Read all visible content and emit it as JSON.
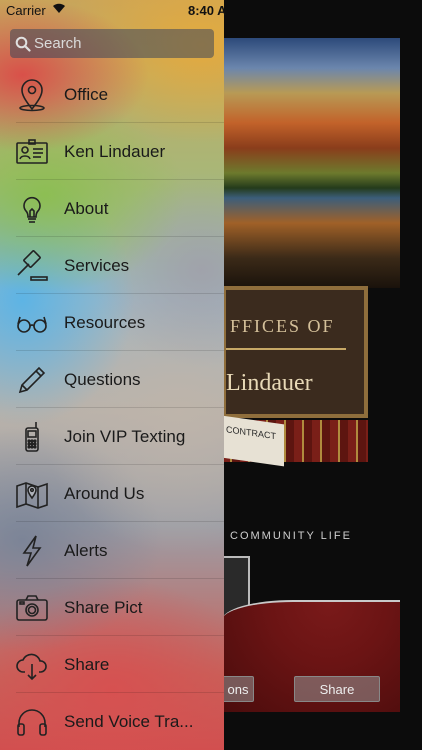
{
  "status_bar": {
    "carrier": "Carrier",
    "time": "8:40 A"
  },
  "search": {
    "placeholder": "Search"
  },
  "menu": {
    "items": [
      {
        "label": "Office",
        "icon": "location-pin-icon"
      },
      {
        "label": "Ken Lindauer",
        "icon": "contact-card-icon"
      },
      {
        "label": "About",
        "icon": "lightbulb-icon"
      },
      {
        "label": "Services",
        "icon": "gavel-icon"
      },
      {
        "label": "Resources",
        "icon": "glasses-icon"
      },
      {
        "label": "Questions",
        "icon": "pencil-icon"
      },
      {
        "label": "Join VIP Texting",
        "icon": "cellphone-icon"
      },
      {
        "label": "Around Us",
        "icon": "map-icon"
      },
      {
        "label": "Alerts",
        "icon": "lightning-icon"
      },
      {
        "label": "Share Pict",
        "icon": "camera-icon"
      },
      {
        "label": "Share",
        "icon": "cloud-download-icon"
      },
      {
        "label": "Send Voice Tra...",
        "icon": "headphones-icon"
      }
    ]
  },
  "background": {
    "sign_line1": "FFICES OF",
    "sign_line2": "Lindauer",
    "contract": "CONTRACT",
    "community": "COMMUNITY LIFE",
    "button_left": "ons",
    "button_right": "Share"
  }
}
